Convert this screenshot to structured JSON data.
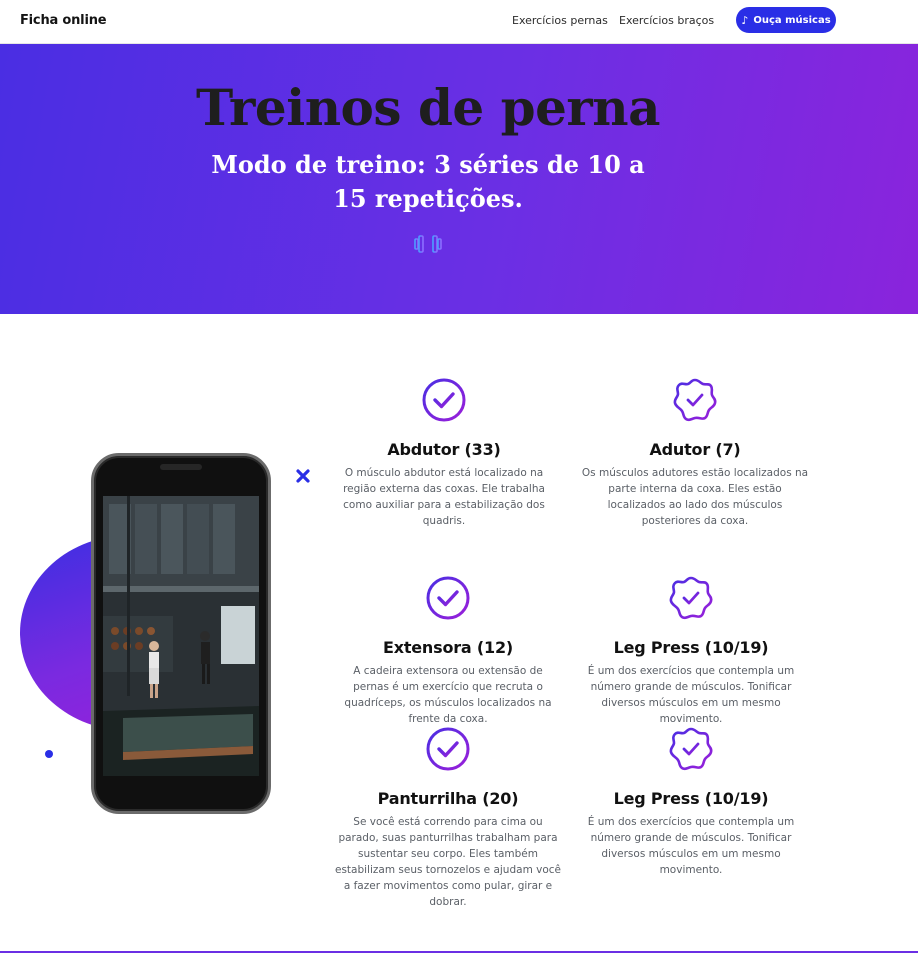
{
  "header": {
    "brand": "Ficha online",
    "nav": [
      {
        "label": "Exercícios pernas"
      },
      {
        "label": "Exercícios braços"
      }
    ],
    "cta_label": "Ouça músicas",
    "cta_icon": "music-note-icon"
  },
  "hero": {
    "title": "Treinos de perna",
    "subtitle": "Modo de treino: 3 séries de 10 a 15 repetições.",
    "icon": "dumbbell-icon",
    "gradient": [
      "#4a2ee3",
      "#8a24dc"
    ]
  },
  "features": [
    {
      "title": "Abdutor (33)",
      "text": "O músculo abdutor está localizado na região externa das coxas. Ele trabalha como auxiliar para a estabilização dos quadris.",
      "icon": "check-circle-icon"
    },
    {
      "title": "Adutor (7)",
      "text": "Os músculos adutores estão localizados na parte interna da coxa. Eles estão localizados ao lado dos músculos posteriores da coxa.",
      "icon": "check-badge-icon"
    },
    {
      "title": "Extensora (12)",
      "text": "A cadeira extensora ou extensão de pernas é um exercício que recruta o quadríceps, os músculos localizados na frente da coxa.",
      "icon": "check-circle-icon"
    },
    {
      "title": "Leg Press (10/19)",
      "text": "É um dos exercícios que contempla um número grande de músculos. Tonificar diversos músculos em um mesmo movimento.",
      "icon": "check-badge-icon"
    },
    {
      "title": "Panturrilha (20)",
      "text": "Se você está correndo para cima ou parado, suas panturrilhas trabalham para sustentar seu corpo. Eles também estabilizam seus tornozelos e ajudam você a fazer movimentos como pular, girar e dobrar.",
      "icon": "check-circle-icon"
    },
    {
      "title": "Leg Press (10/19)",
      "text": "É um dos exercícios que contempla um número grande de músculos. Tonificar diversos músculos em um mesmo movimento.",
      "icon": "check-badge-icon"
    }
  ],
  "colors": {
    "accent": "#2a2ee6",
    "purple": "#6b2fe4",
    "icon_gradient_start": "#4a2ee3",
    "icon_gradient_end": "#9b1fd9"
  }
}
